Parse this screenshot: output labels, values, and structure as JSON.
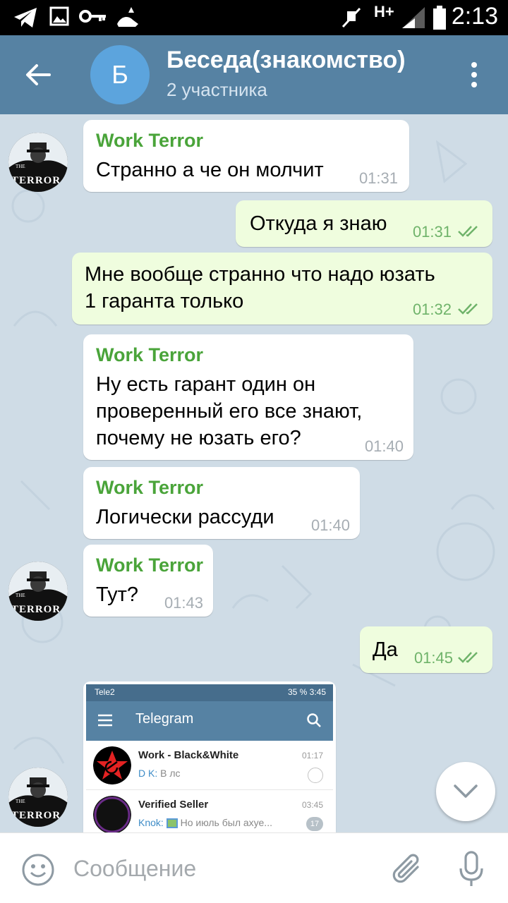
{
  "status_bar": {
    "network": "H+",
    "time": "2:13",
    "icons": [
      "telegram-icon",
      "image-icon",
      "key-icon",
      "pet-icon",
      "mute-icon",
      "signal-icon",
      "battery-icon"
    ]
  },
  "header": {
    "avatar_letter": "Б",
    "title": "Беседа(знакомство)",
    "subtitle": "2 участника",
    "accent": "#5682a3"
  },
  "messages": [
    {
      "dir": "in",
      "sender": "Work Terror",
      "lines": [
        "Странно а че он молчит"
      ],
      "time": "01:31"
    },
    {
      "dir": "out",
      "lines": [
        "Откуда я знаю"
      ],
      "time": "01:31"
    },
    {
      "dir": "out",
      "lines": [
        "Мне вообще странно что надо юзать",
        "1 гаранта только"
      ],
      "time": "01:32"
    },
    {
      "dir": "in",
      "sender": "Work Terror",
      "lines": [
        "Ну есть гарант один он",
        "проверенный его все знают,",
        "почему не юзать его?"
      ],
      "time": "01:40"
    },
    {
      "dir": "in",
      "sender": "Work Terror",
      "lines": [
        "Логически рассуди"
      ],
      "time": "01:40"
    },
    {
      "dir": "in",
      "sender": "Work Terror",
      "lines": [
        "Тут?"
      ],
      "time": "01:43"
    },
    {
      "dir": "out",
      "lines": [
        "Да"
      ],
      "time": "01:45"
    }
  ],
  "avatar_caption": {
    "small": "THE",
    "big": "TERROR"
  },
  "embedded_screenshot": {
    "status_left": "Tele2",
    "status_right": "35 % 3:45",
    "app_title": "Telegram",
    "chats": [
      {
        "name": "Work - Black&White",
        "time": "01:17",
        "who": "D K:",
        "preview": "В лс"
      },
      {
        "name": "Verified Seller",
        "time": "03:45",
        "who": "Knok:",
        "preview": "Но июль был ахуе...",
        "badge": "17"
      }
    ]
  },
  "input": {
    "placeholder": "Сообщение"
  },
  "colors": {
    "sender_name": "#4aa43a",
    "out_bubble": "#effdde",
    "time_out": "#6fb36a"
  }
}
